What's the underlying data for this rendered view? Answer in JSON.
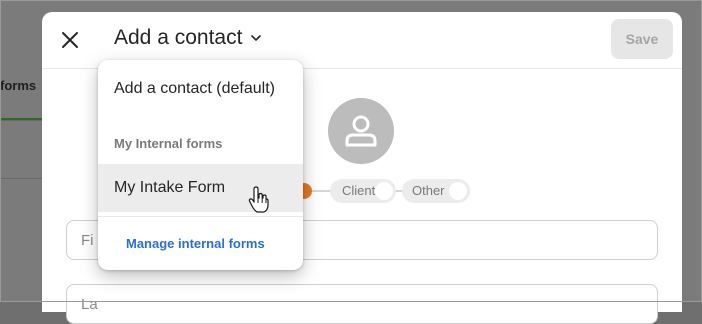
{
  "background": {
    "tab_label": "forms"
  },
  "header": {
    "title": "Add a contact",
    "save_label": "Save",
    "close_icon": "close-icon",
    "chevron_icon": "chevron-down-icon"
  },
  "contact_types": {
    "options": [
      {
        "label": ""
      },
      {
        "label": "Client"
      },
      {
        "label": "Other"
      }
    ]
  },
  "fields": {
    "first_name_placeholder": "Fi",
    "last_name_placeholder": "La"
  },
  "dropdown": {
    "default_item": "Add a contact (default)",
    "section_label": "My Internal forms",
    "items": [
      {
        "label": "My Intake Form"
      }
    ],
    "manage_link": "Manage internal forms"
  },
  "colors": {
    "accent": "#e8781e",
    "link": "#2a6fd6",
    "overlay": "#7b7b7b"
  }
}
